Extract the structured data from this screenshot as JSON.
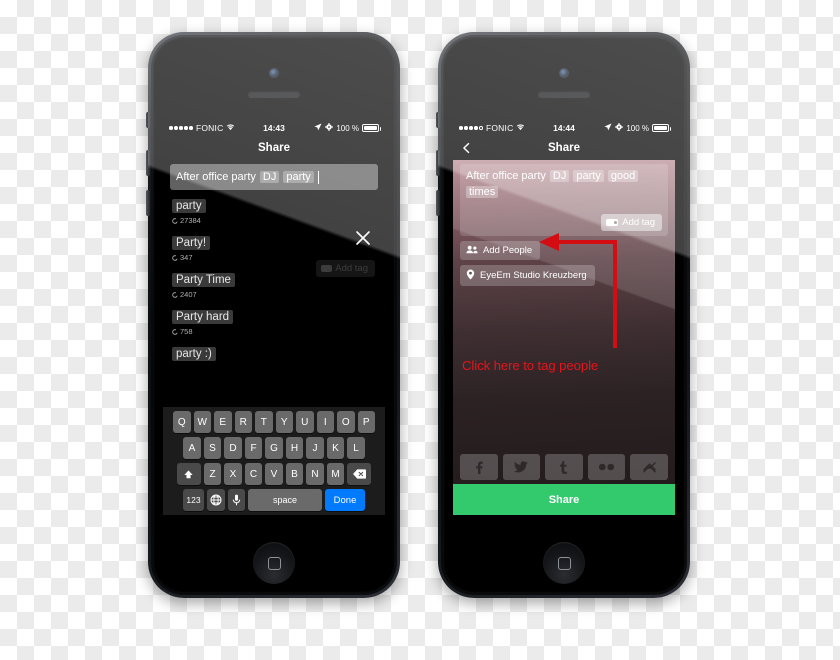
{
  "phones": [
    {
      "id": "left-phone",
      "statusbar": {
        "signal_dots_filled": 5,
        "signal_dots_hollow": 0,
        "carrier": "FONIC",
        "wifi_icon": "wifi-icon",
        "time": "14:43",
        "location_icon": "location-arrow-icon",
        "gear_icon": "gear-icon",
        "battery_pct": "100 %",
        "battery_icon": "battery-full-icon"
      },
      "navbar": {
        "title": "Share",
        "back_icon": null
      },
      "tag_field": {
        "plain_text": "After office party",
        "chips": [
          "DJ",
          "party"
        ],
        "has_caret": true
      },
      "close_icon": "close-x-icon",
      "ghost_add_tag": {
        "label": "Add tag",
        "icon": "tag-icon"
      },
      "suggestions": [
        {
          "tag": "party",
          "count": "27384",
          "icon": "refresh-icon"
        },
        {
          "tag": "Party!",
          "count": "347",
          "icon": "refresh-icon"
        },
        {
          "tag": "Party Time",
          "count": "2407",
          "icon": "refresh-icon"
        },
        {
          "tag": "Party hard",
          "count": "758",
          "icon": "refresh-icon"
        },
        {
          "tag": "party :)",
          "count": "",
          "icon": "refresh-icon"
        }
      ],
      "keyboard": {
        "row1": [
          "Q",
          "W",
          "E",
          "R",
          "T",
          "Y",
          "U",
          "I",
          "O",
          "P"
        ],
        "row2": [
          "A",
          "S",
          "D",
          "F",
          "G",
          "H",
          "J",
          "K",
          "L"
        ],
        "row3": [
          "Z",
          "X",
          "C",
          "V",
          "B",
          "N",
          "M"
        ],
        "shift_icon": "shift-up-arrow-icon",
        "backspace_icon": "backspace-icon",
        "numbers_key": "123",
        "globe_icon": "globe-icon",
        "mic_icon": "microphone-icon",
        "space_key": "space",
        "done_key": "Done"
      }
    },
    {
      "id": "right-phone",
      "statusbar": {
        "signal_dots_filled": 4,
        "signal_dots_hollow": 1,
        "carrier": "FONIC",
        "wifi_icon": "wifi-icon",
        "time": "14:44",
        "location_icon": "location-arrow-icon",
        "gear_icon": "gear-icon",
        "battery_pct": "100 %",
        "battery_icon": "battery-full-icon"
      },
      "navbar": {
        "title": "Share",
        "back_icon": "back-chevron-icon"
      },
      "tag_box": {
        "plain_text": "After office party",
        "chips": [
          "DJ",
          "party",
          "good",
          "times"
        ],
        "add_tag": {
          "label": "Add tag",
          "icon": "tag-icon"
        }
      },
      "add_people": {
        "label": "Add People",
        "icon": "people-icon"
      },
      "location": {
        "label": "EyeEm Studio Kreuzberg",
        "icon": "map-pin-icon"
      },
      "annotation": {
        "text": "Click here to tag people",
        "color": "#e8141b",
        "arrow_icon": "annotation-arrow-icon"
      },
      "social": [
        {
          "name": "facebook",
          "icon": "facebook-icon",
          "glyph": "f"
        },
        {
          "name": "twitter",
          "icon": "twitter-icon",
          "glyph": ""
        },
        {
          "name": "tumblr",
          "icon": "tumblr-icon",
          "glyph": "t"
        },
        {
          "name": "flickr",
          "icon": "flickr-icon",
          "glyph": ""
        },
        {
          "name": "foursquare",
          "icon": "foursquare-icon",
          "glyph": ""
        }
      ],
      "share_button": {
        "label": "Share",
        "color": "#33c96d"
      }
    }
  ]
}
